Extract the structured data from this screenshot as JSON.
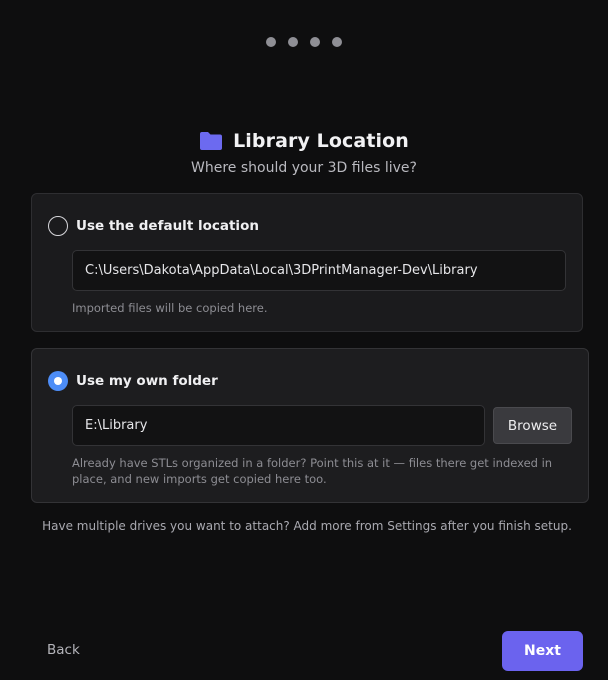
{
  "wizard": {
    "steps": [
      {
        "state": "inactive"
      },
      {
        "state": "inactive"
      },
      {
        "state": "inactive"
      },
      {
        "state": "inactive"
      }
    ]
  },
  "header": {
    "icon": "folder-icon",
    "title": "Library Location",
    "subtitle": "Where should your 3D files live?"
  },
  "options": {
    "default_location": {
      "label": "Use the default location",
      "selected": false,
      "path": "C:\\Users\\Dakota\\AppData\\Local\\3DPrintManager-Dev\\Library",
      "hint": "Imported files will be copied here."
    },
    "own_folder": {
      "label": "Use my own folder",
      "selected": true,
      "path": "E:\\Library",
      "browse_label": "Browse",
      "hint": "Already have STLs organized in a folder? Point this at it — files there get indexed in place, and new imports get copied here too."
    }
  },
  "footer": {
    "note": "Have multiple drives you want to attach? Add more from Settings after you finish setup.",
    "back_label": "Back",
    "next_label": "Next"
  },
  "colors": {
    "accent": "#6b63ee",
    "radio_selected": "#4d8df7",
    "folder_icon": "#6c6af0"
  }
}
